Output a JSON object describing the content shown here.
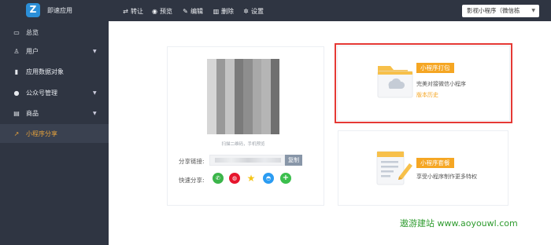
{
  "app": {
    "logo_letter": "Z",
    "name": "即速应用"
  },
  "toolbar": {
    "items": [
      {
        "icon": "transfer-icon",
        "label": "转让"
      },
      {
        "icon": "preview-icon",
        "label": "预览"
      },
      {
        "icon": "edit-icon",
        "label": "编辑"
      },
      {
        "icon": "trash-icon",
        "label": "删除"
      },
      {
        "icon": "gear-icon",
        "label": "设置"
      }
    ],
    "app_select": "影视小程序（微信栋"
  },
  "sidebar": {
    "items": [
      {
        "icon": "monitor-icon",
        "label": "总览",
        "arrow": false,
        "active": false
      },
      {
        "icon": "user-icon",
        "label": "用户",
        "arrow": true,
        "active": false
      },
      {
        "icon": "bar-chart-icon",
        "label": "应用数据对象",
        "arrow": false,
        "active": false
      },
      {
        "icon": "public-account-icon",
        "label": "公众号管理",
        "arrow": true,
        "active": false
      },
      {
        "icon": "shop-icon",
        "label": "商品",
        "arrow": true,
        "active": false
      },
      {
        "icon": "share-icon",
        "label": "小程序分享",
        "arrow": false,
        "active": true
      }
    ]
  },
  "share_card": {
    "qr_caption": "扫描二维码，手机预览",
    "share_link_label": "分享链接:",
    "copy_label": "复制",
    "quick_share_label": "快速分享:",
    "share_icons": [
      "wechat-icon",
      "weibo-icon",
      "star-icon",
      "qq-icon",
      "plus-icon"
    ]
  },
  "package_card": {
    "badge": "小程序打包",
    "desc": "完美对接微信小程序",
    "history_link": "版本历史"
  },
  "plan_card": {
    "badge": "小程序套餐",
    "desc": "享受小程序制作更多特权"
  },
  "watermark": "遨游建站  www.aoyouwl.com",
  "colors": {
    "topbar_bg": "#2f3542",
    "sidebar_bg": "#2f3542",
    "active_accent": "#e6a23c",
    "badge_orange": "#f5a623",
    "highlight_red": "#e53935",
    "copy_button": "#8896a8",
    "watermark_green": "#2e9b2e"
  }
}
